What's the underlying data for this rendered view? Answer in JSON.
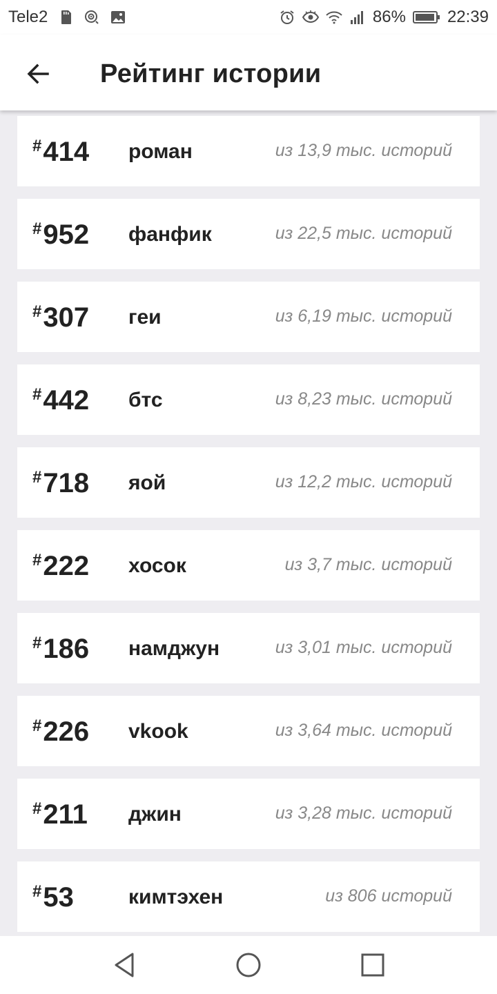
{
  "status_bar": {
    "carrier": "Tele2",
    "battery": "86%",
    "time": "22:39"
  },
  "header": {
    "title": "Рейтинг истории"
  },
  "ranking": {
    "hash": "#",
    "items": [
      {
        "rank": "414",
        "tag": "роман",
        "count": "из 13,9 тыс. историй"
      },
      {
        "rank": "952",
        "tag": "фанфик",
        "count": "из 22,5 тыс. историй"
      },
      {
        "rank": "307",
        "tag": "геи",
        "count": "из 6,19 тыс. историй"
      },
      {
        "rank": "442",
        "tag": "бтс",
        "count": "из 8,23 тыс. историй"
      },
      {
        "rank": "718",
        "tag": "яой",
        "count": "из 12,2 тыс. историй"
      },
      {
        "rank": "222",
        "tag": "хосок",
        "count": "из 3,7 тыс. историй"
      },
      {
        "rank": "186",
        "tag": "намджун",
        "count": "из 3,01 тыс. историй"
      },
      {
        "rank": "226",
        "tag": "vkook",
        "count": "из 3,64 тыс. историй"
      },
      {
        "rank": "211",
        "tag": "джин",
        "count": "из 3,28 тыс. историй"
      },
      {
        "rank": "53",
        "tag": "кимтэхен",
        "count": "из 806 историй"
      }
    ]
  },
  "icons": {
    "back": "arrow-left-icon",
    "nav_back": "triangle-back-icon",
    "nav_home": "circle-home-icon",
    "nav_recents": "square-recents-icon"
  },
  "colors": {
    "background": "#eeedf1",
    "card": "#ffffff",
    "text": "#222222",
    "muted": "#888888"
  }
}
